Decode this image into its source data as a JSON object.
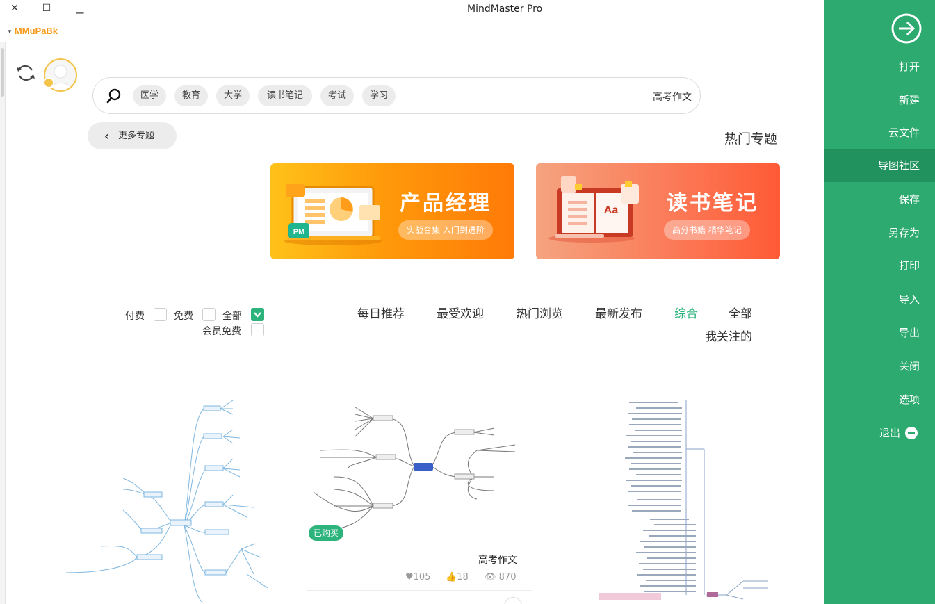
{
  "window": {
    "title": "MindMaster Pro",
    "close": "✕",
    "maximize": "☐",
    "minimize": "▁"
  },
  "user": {
    "name": "MMuPaBk"
  },
  "search": {
    "value": "高考作文",
    "tags": [
      "学习",
      "考试",
      "读书笔记",
      "大学",
      "教育",
      "医学"
    ]
  },
  "topics": {
    "title": "热门专题",
    "more": "更多专题",
    "banners": [
      {
        "title": "读书笔记",
        "subtitle": "高分书籍 精华笔记"
      },
      {
        "title": "产品经理",
        "subtitle": "实战合集 入门到进阶"
      }
    ]
  },
  "filters": {
    "tabs": [
      "全部",
      "综合",
      "最新发布",
      "热门浏览",
      "最受欢迎",
      "每日推荐",
      "我关注的"
    ],
    "active_tab": "综合",
    "price": [
      "全部",
      "免费",
      "付费",
      "会员免费"
    ],
    "price_selected": "全部"
  },
  "cards": [
    {
      "title": "高考作文",
      "views": "870",
      "likes": "18",
      "favorites": "105",
      "badge": "已购买"
    }
  ],
  "sidebar": {
    "items": [
      "打开",
      "新建",
      "云文件",
      "导图社区",
      "保存",
      "另存为",
      "打印",
      "导入",
      "导出",
      "关闭",
      "选项"
    ],
    "active": "导图社区",
    "exit": "退出"
  },
  "colors": {
    "accent": "#2db37c",
    "sidebar": "#2daa6f",
    "user": "#f59a1a"
  }
}
